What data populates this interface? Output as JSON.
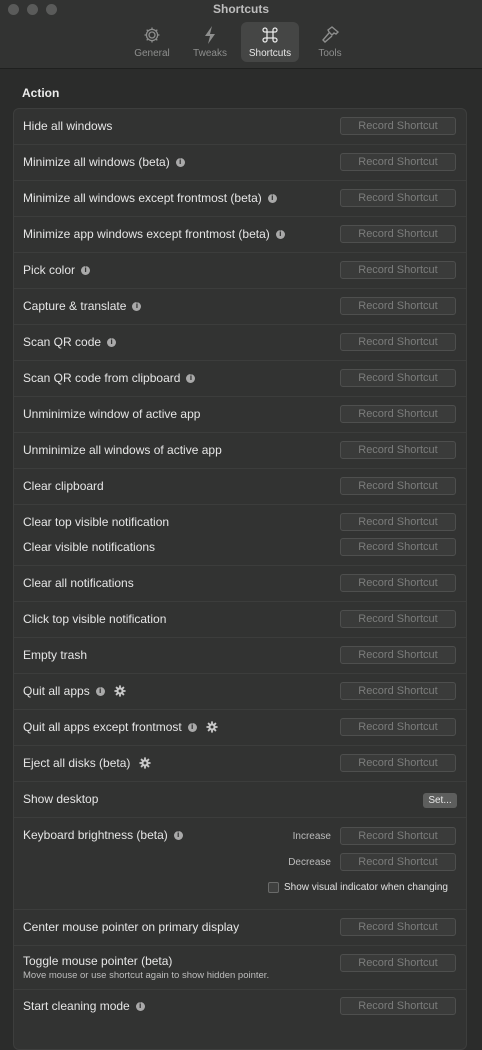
{
  "window": {
    "title": "Shortcuts"
  },
  "tabs": [
    {
      "label": "General",
      "icon": "gear-icon"
    },
    {
      "label": "Tweaks",
      "icon": "bolt-icon"
    },
    {
      "label": "Shortcuts",
      "icon": "command-icon"
    },
    {
      "label": "Tools",
      "icon": "hammer-icon"
    }
  ],
  "section": {
    "title": "Action"
  },
  "record_label": "Record Shortcut",
  "rows": [
    {
      "label": "Hide all windows"
    },
    {
      "label": "Minimize all windows (beta)"
    },
    {
      "label": "Minimize all windows except frontmost (beta)"
    },
    {
      "label": "Minimize app windows except frontmost (beta)"
    },
    {
      "label": "Pick color"
    },
    {
      "label": "Capture & translate"
    },
    {
      "label": "Scan QR code"
    },
    {
      "label": "Scan QR code from clipboard"
    },
    {
      "label": "Unminimize window of active app"
    },
    {
      "label": "Unminimize all windows of active app"
    },
    {
      "label": "Clear clipboard"
    },
    {
      "label": "Clear top visible notification",
      "label2": "Clear visible notifications"
    },
    {
      "label": "Clear all notifications"
    },
    {
      "label": "Click top visible notification"
    },
    {
      "label": "Empty trash"
    },
    {
      "label": "Quit all apps"
    },
    {
      "label": "Quit all apps except frontmost"
    },
    {
      "label": "Eject all disks (beta)"
    },
    {
      "label": "Show desktop",
      "button": "Set..."
    },
    {
      "label": "Keyboard brightness (beta)",
      "increase": "Increase",
      "decrease": "Decrease",
      "checkbox": "Show visual indicator when changing"
    },
    {
      "label": "Center mouse pointer on primary display"
    },
    {
      "label": "Toggle mouse pointer (beta)",
      "description": "Move mouse or use shortcut again to show hidden pointer."
    },
    {
      "label": "Start cleaning mode"
    }
  ]
}
